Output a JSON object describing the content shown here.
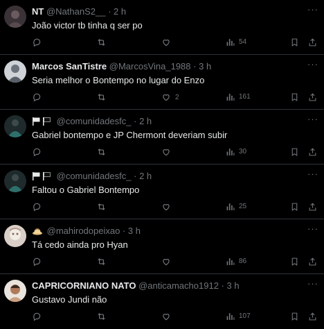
{
  "tweets": [
    {
      "name": "NT",
      "handle": "@NathanS2__",
      "time": "2 h",
      "text": "João victor tb tinha q ser po",
      "replies": "",
      "likes": "",
      "views": "54",
      "has_flags": false,
      "has_emoji": false,
      "avatar_color": "#3a3236"
    },
    {
      "name": "Marcos SanTistre",
      "handle": "@MarcosVina_1988",
      "time": "3 h",
      "text": "Seria melhor o Bontempo no lugar do Enzo",
      "replies": "",
      "likes": "2",
      "views": "161",
      "has_flags": false,
      "has_emoji": false,
      "avatar_color": "#8a8f99"
    },
    {
      "name": "",
      "handle": "@comunidadesfc_",
      "time": "2 h",
      "text": "Gabriel bontempo e JP Chermont deveriam subir",
      "replies": "",
      "likes": "",
      "views": "30",
      "has_flags": true,
      "has_emoji": false,
      "avatar_color": "#1f2a2c"
    },
    {
      "name": "",
      "handle": "@comunidadesfc_",
      "time": "2 h",
      "text": "Faltou o Gabriel Bontempo",
      "replies": "",
      "likes": "",
      "views": "25",
      "has_flags": true,
      "has_emoji": false,
      "avatar_color": "#1f2a2c"
    },
    {
      "name": "",
      "handle": "@mahirodopeixao",
      "time": "3 h",
      "text": "Tá cedo ainda pro Hyan",
      "replies": "",
      "likes": "",
      "views": "86",
      "has_flags": false,
      "has_emoji": true,
      "avatar_color": "#d9cfc8"
    },
    {
      "name": "CAPRICORNIANO NATO",
      "handle": "@anticamacho1912",
      "time": "3 h",
      "text": "Gustavo Jundi não",
      "replies": "",
      "likes": "",
      "views": "107",
      "has_flags": false,
      "has_emoji": false,
      "avatar_color": "#b07a5a"
    }
  ],
  "separator": "·",
  "more_label": "···",
  "colors": {
    "background": "#000000",
    "text": "#e7e9ea",
    "muted": "#71767b",
    "border": "#2f3336"
  }
}
